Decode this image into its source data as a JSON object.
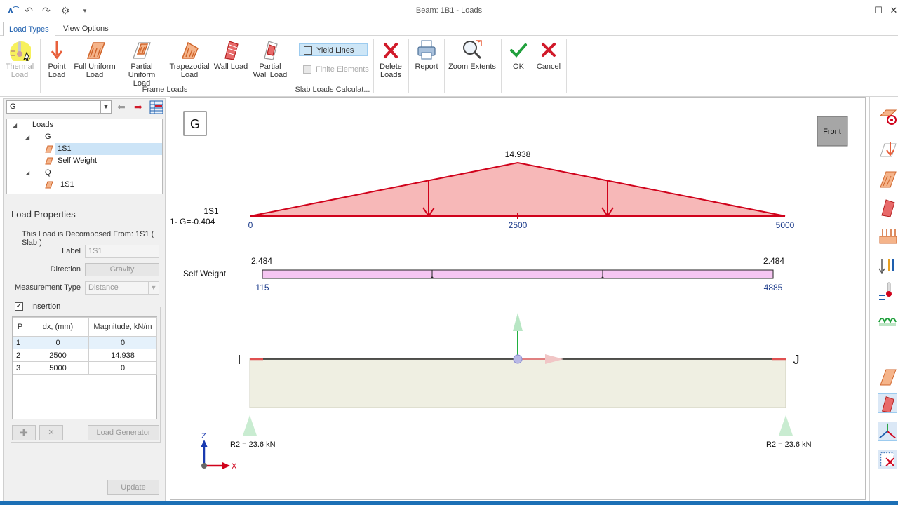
{
  "window": {
    "title": "Beam: 1B1 - Loads",
    "controls": [
      "minimize",
      "maximize",
      "close"
    ]
  },
  "quick_access": [
    "app-icon",
    "undo-icon",
    "redo-icon",
    "settings-icon",
    "dropdown-icon"
  ],
  "tabs": [
    {
      "label": "Load Types",
      "active": true
    },
    {
      "label": "View Options",
      "active": false
    }
  ],
  "ribbon": {
    "thermal": {
      "line1": "Thermal",
      "line2": "Load",
      "enabled": false
    },
    "frame_loads": {
      "group_label": "Frame Loads",
      "buttons": [
        {
          "line1": "Point",
          "line2": "Load",
          "icon": "point-load-icon"
        },
        {
          "line1": "Full Uniform",
          "line2": "Load",
          "icon": "full-uniform-load-icon"
        },
        {
          "line1": "Partial",
          "line2": "Uniform Load",
          "icon": "partial-uniform-load-icon"
        },
        {
          "line1": "Trapezodial",
          "line2": "Load",
          "icon": "trapezoidal-load-icon"
        },
        {
          "line1": "Wall Load",
          "line2": "",
          "icon": "wall-load-icon"
        },
        {
          "line1": "Partial",
          "line2": "Wall Load",
          "icon": "partial-wall-load-icon"
        }
      ]
    },
    "slab_loads": {
      "group_label": "Slab Loads Calculat...",
      "yield_lines": "Yield Lines",
      "finite_elements": "Finite Elements"
    },
    "delete": {
      "line1": "Delete",
      "line2": "Loads"
    },
    "report": {
      "line1": "Report"
    },
    "zoom": {
      "line1": "Zoom Extents"
    },
    "ok": {
      "line1": "OK"
    },
    "cancel": {
      "line1": "Cancel"
    }
  },
  "left": {
    "combo_value": "G",
    "tree": {
      "root": "Loads",
      "g": "G",
      "g_item1": "1S1",
      "g_item2": "Self Weight",
      "q": "Q",
      "q_item1": "1S1"
    },
    "props": {
      "heading": "Load Properties",
      "decomposed": "This Load is Decomposed From: 1S1 ( Slab )",
      "label_label": "Label",
      "label_value": "1S1",
      "direction_label": "Direction",
      "direction_value": "Gravity",
      "mtype_label": "Measurement Type",
      "mtype_value": "Distance",
      "insertion_label": "Insertion",
      "insertion_checked": true
    },
    "table": {
      "headers": [
        "P",
        "dx, (mm)",
        "Magnitude, kN/m"
      ],
      "rows": [
        [
          "1",
          "0",
          "0"
        ],
        [
          "2",
          "2500",
          "14.938"
        ],
        [
          "3",
          "5000",
          "0"
        ]
      ]
    },
    "load_generator": "Load Generator",
    "update": "Update"
  },
  "canvas": {
    "case_label": "G",
    "view_button": "Front",
    "load1": {
      "name": "1S1",
      "subname": "1- G=-0.404",
      "peak": "14.938",
      "x_start": "0",
      "x_mid": "2500",
      "x_end": "5000"
    },
    "load2": {
      "name": "Self Weight",
      "left_value": "2.484",
      "right_value": "2.484",
      "x_start": "115",
      "x_end": "4885"
    },
    "beam": {
      "start": "I",
      "end": "J"
    },
    "reactions": {
      "left": "R2 = 23.6 kN",
      "right": "R2 = 23.6 kN"
    },
    "axes": {
      "z": "Z",
      "x": "X"
    },
    "colors": {
      "trap_fill": "#f7b8b8",
      "trap_stroke": "#d0021b",
      "self_weight_fill": "#f6c6f2",
      "beam_fill": "#efefe2",
      "value_blue": "#1a3a8a"
    }
  },
  "rightbar_icons": [
    "trapezoid-load-icon",
    "point-load-icon",
    "uniform-load-icon",
    "wall-load-icon",
    "area-load-icon",
    "moment-load-icon",
    "thermal-load-icon",
    "spring-load-icon",
    "frame-load-icon",
    "wall-view-icon",
    "axis-icon",
    "grid-delete-icon"
  ]
}
